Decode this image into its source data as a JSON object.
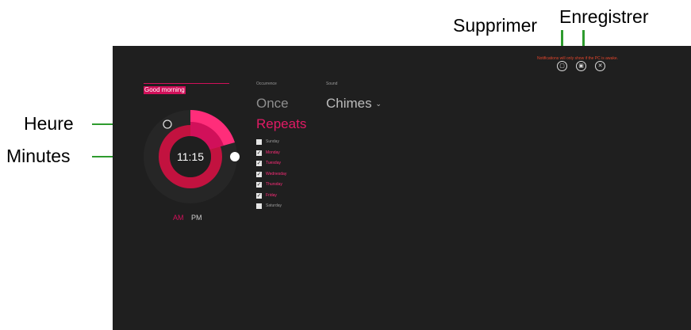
{
  "callouts": {
    "delete": "Supprimer",
    "save": "Enregistrer",
    "hour": "Heure",
    "minutes": "Minutes"
  },
  "notification": "Notifications will only show if the PC is awake.",
  "alarm": {
    "name": "Good morning",
    "time": "11:15",
    "am": "AM",
    "pm": "PM",
    "selected_period": "AM"
  },
  "occurrence": {
    "heading": "Occurrence",
    "once": "Once",
    "repeats": "Repeats",
    "selected": "Repeats"
  },
  "sound": {
    "heading": "Sound",
    "value": "Chimes",
    "chevron": "⌄"
  },
  "days": [
    {
      "label": "Sunday",
      "checked": false
    },
    {
      "label": "Monday",
      "checked": true
    },
    {
      "label": "Tuesday",
      "checked": true
    },
    {
      "label": "Wednesday",
      "checked": true
    },
    {
      "label": "Thursday",
      "checked": true
    },
    {
      "label": "Friday",
      "checked": true
    },
    {
      "label": "Saturday",
      "checked": false
    }
  ],
  "icons": {
    "delete": "trash-icon",
    "save": "save-icon",
    "close": "close-icon",
    "check": "✓"
  },
  "colors": {
    "accent": "#d1105a",
    "accent_light": "#ff2d7a",
    "background": "#1f1f1f",
    "callout_line": "#2e9b2e",
    "notification": "#e2452b"
  }
}
